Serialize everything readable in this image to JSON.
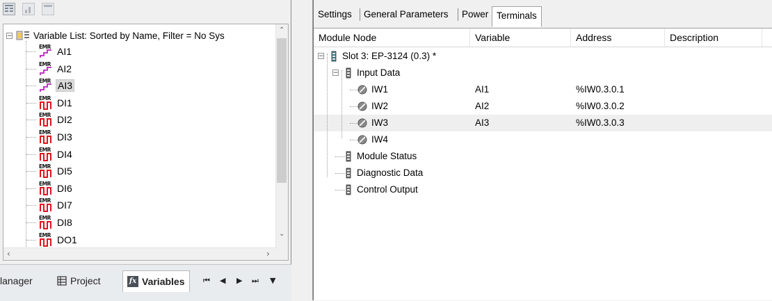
{
  "left": {
    "toolbar": [
      "grid-icon",
      "chart-icon",
      "window-icon"
    ],
    "tree": {
      "root_label": "Variable List: Sorted by Name, Filter = No Sys",
      "items": [
        {
          "label": "AI1",
          "kind": "analog"
        },
        {
          "label": "AI2",
          "kind": "analog"
        },
        {
          "label": "AI3",
          "kind": "analog",
          "selected": true
        },
        {
          "label": "DI1",
          "kind": "digital"
        },
        {
          "label": "DI2",
          "kind": "digital"
        },
        {
          "label": "DI3",
          "kind": "digital"
        },
        {
          "label": "DI4",
          "kind": "digital"
        },
        {
          "label": "DI5",
          "kind": "digital"
        },
        {
          "label": "DI6",
          "kind": "digital"
        },
        {
          "label": "DI7",
          "kind": "digital"
        },
        {
          "label": "DI8",
          "kind": "digital"
        },
        {
          "label": "DO1",
          "kind": "digital"
        }
      ],
      "icon_text": "EMR"
    },
    "bottom_tabs": {
      "manager": "lanager",
      "project": "Project",
      "variables": "Variables",
      "nav": [
        "⏮",
        "◀",
        "▶",
        "⏭",
        "▼"
      ]
    }
  },
  "right": {
    "tabs": [
      "Settings",
      "General Parameters",
      "Power",
      "Terminals"
    ],
    "active_tab": "Terminals",
    "columns": [
      "Module Node",
      "Variable",
      "Address",
      "Description"
    ],
    "rows": [
      {
        "node": "Slot 3:  EP-3124  (0.3) *",
        "variable": "",
        "address": ""
      },
      {
        "node": "Input Data",
        "variable": "",
        "address": ""
      },
      {
        "node": "IW1",
        "variable": "AI1",
        "address": "%IW0.3.0.1"
      },
      {
        "node": "IW2",
        "variable": "AI2",
        "address": "%IW0.3.0.2"
      },
      {
        "node": "IW3",
        "variable": "AI3",
        "address": "%IW0.3.0.3",
        "selected": true
      },
      {
        "node": "IW4",
        "variable": "",
        "address": ""
      },
      {
        "node": "Module Status",
        "variable": "",
        "address": ""
      },
      {
        "node": "Diagnostic Data",
        "variable": "",
        "address": ""
      },
      {
        "node": "Control Output",
        "variable": "",
        "address": ""
      }
    ]
  },
  "colors": {
    "analog_icon": "#c03bc4",
    "digital_icon": "#e0141e",
    "selected_row": "#efefef"
  }
}
